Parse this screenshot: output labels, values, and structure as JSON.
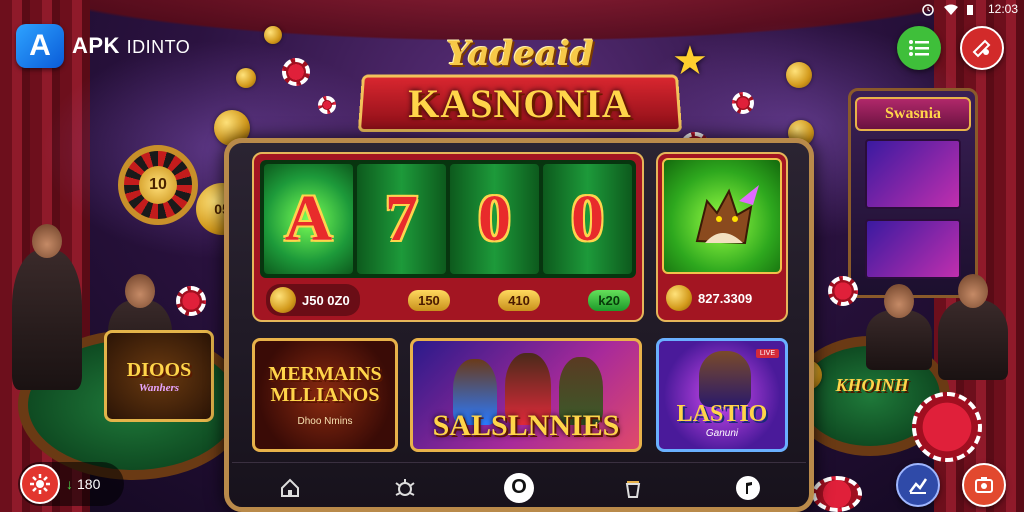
{
  "status_bar": {
    "time": "12:03"
  },
  "brand": {
    "badge": "A",
    "name": "APK",
    "suffix": "IDINTO"
  },
  "banner": {
    "script_title": "Yadeaid",
    "main_title": "KASNONIA"
  },
  "roulette": {
    "label": "10"
  },
  "coin_badge": {
    "label": "05"
  },
  "jackpot": {
    "reels": [
      "A",
      "7",
      "0",
      "0"
    ],
    "main_payout": "J50 0Z0",
    "pills": [
      "150",
      "410",
      "k20"
    ]
  },
  "featured_game": {
    "amount": "827.3309"
  },
  "background_machine": {
    "sign": "Swasnia"
  },
  "side_cards": {
    "left_title": "DIOOS",
    "left_sub": "Wanhers",
    "right_title": "KHOINH"
  },
  "games": [
    {
      "title": "MERMAINS MLLIANOS",
      "sub": "Dhoo Nmins"
    },
    {
      "title": "SALSLNNIES"
    },
    {
      "title": "LASTIO",
      "sub": "Ganuni",
      "tag": "LIVE"
    }
  ],
  "bottom_left": {
    "count": "180"
  },
  "colors": {
    "accent_gold": "#e6b65a",
    "brand_blue": "#0a5bd8",
    "jackpot_red": "#a31522",
    "menu_green": "#3fbf3a"
  },
  "icons": [
    "home-icon",
    "bug-icon",
    "casino-icon",
    "cup-icon",
    "music-icon",
    "menu-icon",
    "gift-icon",
    "chart-icon",
    "camera-icon"
  ]
}
